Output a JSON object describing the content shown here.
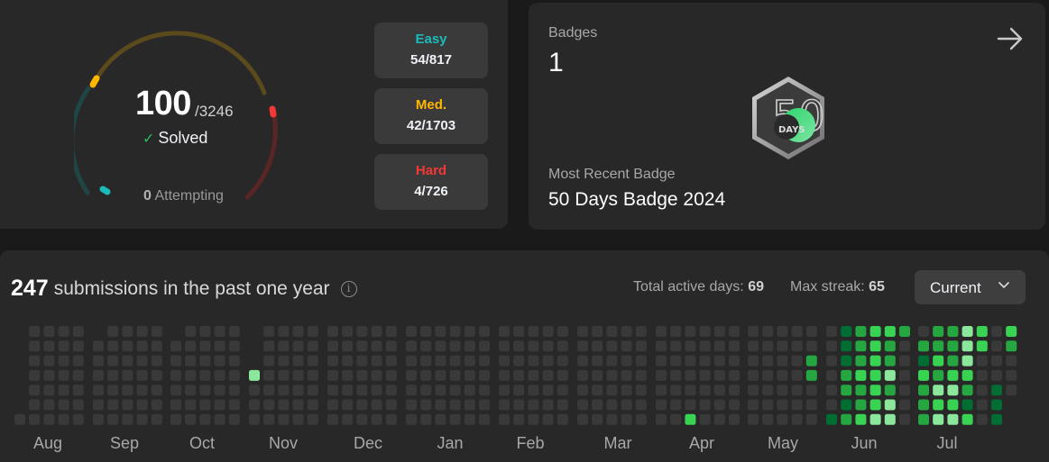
{
  "progress": {
    "solved_count": "100",
    "total": "/3246",
    "solved_label": "Solved",
    "attempting_count": "0",
    "attempting_label": "Attempting",
    "difficulties": [
      {
        "label": "Easy",
        "value": "54/817",
        "color": "#1cbaba"
      },
      {
        "label": "Med.",
        "value": "42/1703",
        "color": "#ffb700"
      },
      {
        "label": "Hard",
        "value": "4/726",
        "color": "#f63737"
      }
    ]
  },
  "badges": {
    "title": "Badges",
    "count": "1",
    "badge_number": "50",
    "badge_unit": "DAYS",
    "recent_label": "Most Recent Badge",
    "recent_name": "50 Days Badge 2024"
  },
  "heatmap": {
    "count": "247",
    "headline": "submissions in the past one year",
    "active_days_label": "Total active days:",
    "active_days": "69",
    "max_streak_label": "Max streak:",
    "max_streak": "65",
    "year_selector": "Current",
    "months": [
      "Aug",
      "Sep",
      "Oct",
      "Nov",
      "Dec",
      "Jan",
      "Feb",
      "Mar",
      "Apr",
      "May",
      "Jun",
      "Jul"
    ],
    "colors": {
      "empty": "#393939",
      "level1": "#0e4429",
      "level2": "#006d32",
      "level3": "#26a641",
      "level4": "#39d353",
      "level5": "#8ae79b"
    }
  }
}
